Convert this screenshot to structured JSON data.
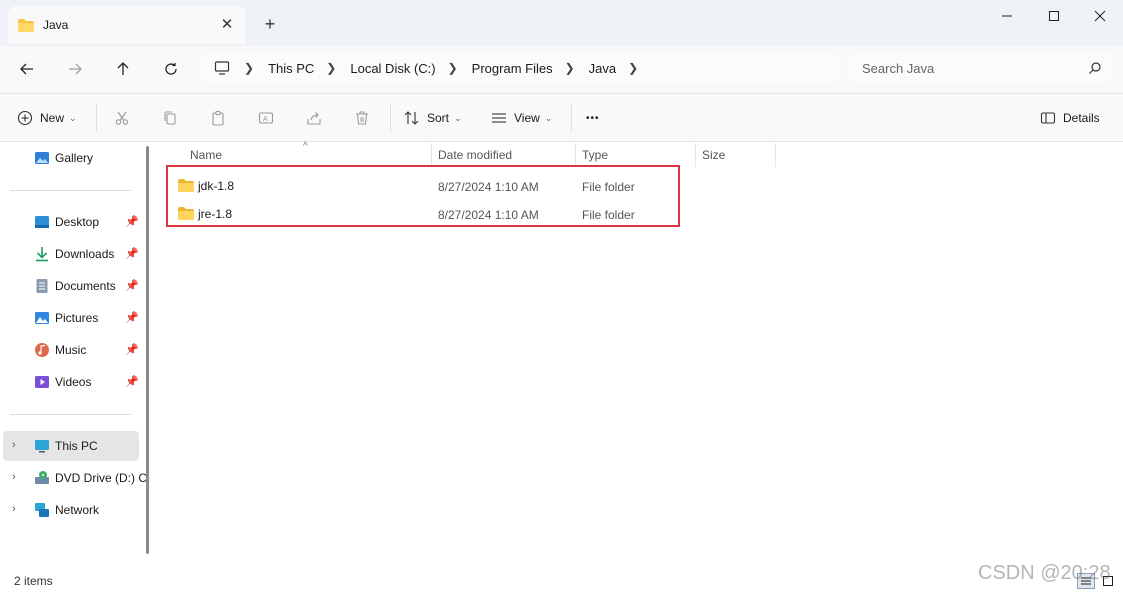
{
  "window": {
    "tab_title": "Java",
    "close_tab_glyph": "✕",
    "new_tab_glyph": "+"
  },
  "address": {
    "breadcrumbs": [
      "This PC",
      "Local Disk (C:)",
      "Program Files",
      "Java"
    ],
    "search_placeholder": "Search Java"
  },
  "toolbar": {
    "new_label": "New",
    "sort_label": "Sort",
    "view_label": "View",
    "more_label": "•••",
    "details_label": "Details",
    "icons": [
      "cut-icon",
      "copy-icon",
      "paste-icon",
      "rename-icon",
      "share-icon",
      "delete-icon"
    ]
  },
  "sidebar": {
    "items": [
      {
        "label": "Gallery",
        "icon": "gallery-icon"
      },
      {
        "label": "Desktop",
        "icon": "desktop-icon",
        "pinned": true
      },
      {
        "label": "Downloads",
        "icon": "download-icon",
        "pinned": true
      },
      {
        "label": "Documents",
        "icon": "documents-icon",
        "pinned": true
      },
      {
        "label": "Pictures",
        "icon": "pictures-icon",
        "pinned": true
      },
      {
        "label": "Music",
        "icon": "music-icon",
        "pinned": true
      },
      {
        "label": "Videos",
        "icon": "videos-icon",
        "pinned": true
      },
      {
        "label": "This PC",
        "icon": "computer-icon",
        "selected": true
      },
      {
        "label": "DVD Drive (D:) C",
        "icon": "dvd-icon"
      },
      {
        "label": "Network",
        "icon": "network-icon"
      }
    ]
  },
  "columns": {
    "name": "Name",
    "date": "Date modified",
    "type": "Type",
    "size": "Size"
  },
  "files": [
    {
      "name": "jdk-1.8",
      "date": "8/27/2024 1:10 AM",
      "type": "File folder",
      "size": ""
    },
    {
      "name": "jre-1.8",
      "date": "8/27/2024 1:10 AM",
      "type": "File folder",
      "size": ""
    }
  ],
  "status": {
    "item_count": "2 items"
  },
  "watermark": "CSDN @20:28",
  "colors": {
    "highlight_border": "#d9363e",
    "folder_yellow": "#f5c542",
    "selected_bg": "#e5e5e5"
  }
}
